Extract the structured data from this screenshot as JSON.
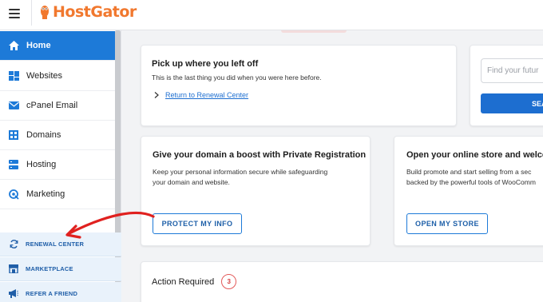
{
  "header": {
    "brand": "HostGator",
    "brand_color": "#f1782e"
  },
  "sidebar": {
    "items": [
      {
        "label": "Home",
        "icon": "home-icon",
        "active": true
      },
      {
        "label": "Websites",
        "icon": "websites-icon"
      },
      {
        "label": "cPanel Email",
        "icon": "email-icon"
      },
      {
        "label": "Domains",
        "icon": "domains-icon"
      },
      {
        "label": "Hosting",
        "icon": "hosting-icon"
      },
      {
        "label": "Marketing",
        "icon": "marketing-icon"
      }
    ],
    "sub_items": [
      {
        "label": "RENEWAL CENTER",
        "icon": "refresh-icon"
      },
      {
        "label": "MARKETPLACE",
        "icon": "marketplace-icon"
      },
      {
        "label": "REFER A FRIEND",
        "icon": "megaphone-icon"
      }
    ],
    "accent": "#1d7ad8"
  },
  "pickup": {
    "title": "Pick up where you left off",
    "subtitle": "This is the last thing you did when you were here before.",
    "link": "Return to Renewal Center"
  },
  "search": {
    "placeholder": "Find your futur",
    "button": "SEA"
  },
  "privacy": {
    "title": "Give your domain a boost with Private Registration",
    "desc_line1": "Keep your personal information secure while safeguarding",
    "desc_line2": "your domain and website.",
    "button": "PROTECT MY INFO"
  },
  "store": {
    "title": "Open your online store and welcom",
    "desc_line1": "Build promote and start selling from a sec",
    "desc_line2": "backed by the powerful tools of WooComm",
    "button": "OPEN MY STORE"
  },
  "actions": {
    "title": "Action Required",
    "count": "3"
  },
  "annotation_color": "#e0211f"
}
